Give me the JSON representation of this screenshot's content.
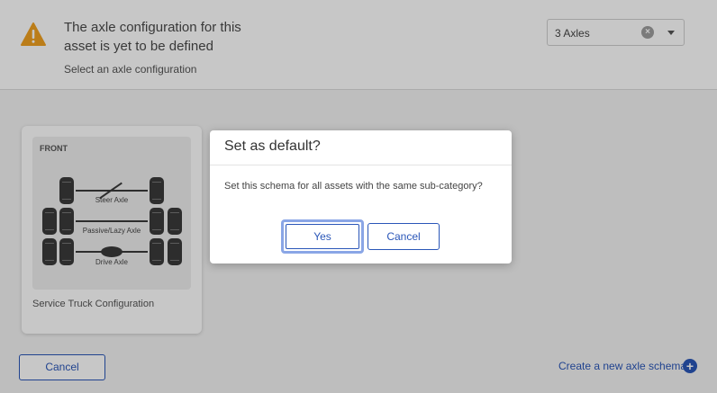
{
  "header": {
    "title": "The axle configuration for this asset is yet to be defined",
    "subtitle": "Select an axle configuration",
    "select": {
      "value": "3 Axles"
    }
  },
  "card": {
    "front_label": "FRONT",
    "axles": [
      "Steer Axle",
      "Passive/Lazy Axle",
      "Drive Axle"
    ],
    "title": "Service Truck Configuration"
  },
  "footer": {
    "cancel_label": "Cancel",
    "create_link": "Create a new axle schema"
  },
  "modal": {
    "title": "Set as default?",
    "body": "Set this schema for all assets with the same sub-category?",
    "yes_label": "Yes",
    "cancel_label": "Cancel"
  },
  "colors": {
    "accent": "#2a56b8",
    "warning": "#f0a020",
    "focus_ring": "#8aa6e6"
  }
}
